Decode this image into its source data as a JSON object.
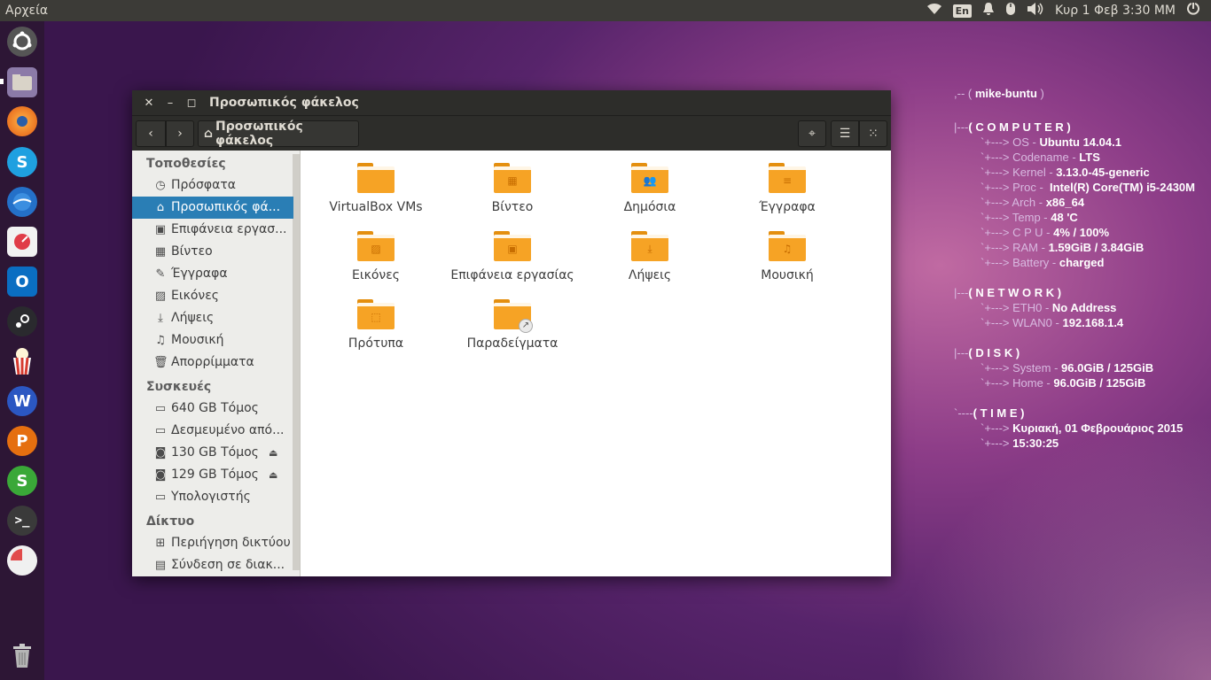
{
  "top_panel": {
    "app_title": "Αρχεία",
    "keyboard": "En",
    "datetime": "Κυρ  1 Φεβ  3:30 MM"
  },
  "window": {
    "title": "Προσωπικός φάκελος",
    "location": "Προσωπικός φάκελος"
  },
  "sidebar": {
    "places_header": "Τοποθεσίες",
    "places": [
      {
        "label": "Πρόσφατα",
        "icon": "clock-icon",
        "glyph": "◷"
      },
      {
        "label": "Προσωπικός φά...",
        "icon": "home-icon",
        "glyph": "⌂"
      },
      {
        "label": "Επιφάνεια εργασ...",
        "icon": "desktop-icon",
        "glyph": "▣"
      },
      {
        "label": "Βίντεο",
        "icon": "film-icon",
        "glyph": "▦"
      },
      {
        "label": "Έγγραφα",
        "icon": "document-icon",
        "glyph": "✎"
      },
      {
        "label": "Εικόνες",
        "icon": "image-icon",
        "glyph": "▨"
      },
      {
        "label": "Λήψεις",
        "icon": "download-icon",
        "glyph": "⤓"
      },
      {
        "label": "Μουσική",
        "icon": "music-icon",
        "glyph": "♫"
      },
      {
        "label": "Απορρίμματα",
        "icon": "trash-icon",
        "glyph": "🗑"
      }
    ],
    "devices_header": "Συσκευές",
    "devices": [
      {
        "label": "640 GB Τόμος",
        "icon": "drive-icon",
        "glyph": "▭"
      },
      {
        "label": "Δεσμευμένο από...",
        "icon": "drive-icon",
        "glyph": "▭"
      },
      {
        "label": "130 GB Τόμος",
        "icon": "usb-drive-icon",
        "glyph": "◙"
      },
      {
        "label": "129 GB Τόμος",
        "icon": "usb-drive-icon",
        "glyph": "◙"
      },
      {
        "label": "Υπολογιστής",
        "icon": "computer-icon",
        "glyph": "▭"
      }
    ],
    "network_header": "Δίκτυο",
    "network": [
      {
        "label": "Περιήγηση δικτύου",
        "icon": "network-icon",
        "glyph": "⊞"
      },
      {
        "label": "Σύνδεση σε διακ...",
        "icon": "server-icon",
        "glyph": "▤"
      }
    ]
  },
  "folders": [
    {
      "label": "VirtualBox VMs",
      "emblem": ""
    },
    {
      "label": "Βίντεο",
      "emblem": "▦"
    },
    {
      "label": "Δημόσια",
      "emblem": "👥"
    },
    {
      "label": "Έγγραφα",
      "emblem": "≡"
    },
    {
      "label": "Εικόνες",
      "emblem": "▨"
    },
    {
      "label": "Επιφάνεια εργασίας",
      "emblem": "▣"
    },
    {
      "label": "Λήψεις",
      "emblem": "⤓"
    },
    {
      "label": "Μουσική",
      "emblem": "♫"
    },
    {
      "label": "Πρότυπα",
      "emblem": "⬚"
    },
    {
      "label": "Παραδείγματα",
      "emblem": "",
      "badge": "↗"
    }
  ],
  "conky": {
    "hostname": "mike-buntu",
    "computer_header": "( C O M P U T E R )",
    "computer": [
      {
        "k": "OS",
        "v": "Ubuntu 14.04.1"
      },
      {
        "k": "Codename",
        "v": "LTS"
      },
      {
        "k": "Kernel",
        "v": "3.13.0-45-generic"
      },
      {
        "k": "Proc",
        "v": " Intel(R) Core(TM) i5-2430M"
      },
      {
        "k": "Arch",
        "v": "x86_64"
      },
      {
        "k": "Temp",
        "v": "48 'C"
      },
      {
        "k": "C P U",
        "v": "4% / 100%"
      },
      {
        "k": "RAM",
        "v": "1.59GiB / 3.84GiB"
      },
      {
        "k": "Battery",
        "v": "charged"
      }
    ],
    "network_header": "( N E T W O R K )",
    "network": [
      {
        "k": "ETH0",
        "v": "No Address"
      },
      {
        "k": "WLAN0",
        "v": "192.168.1.4"
      }
    ],
    "disk_header": "( D I S K )",
    "disk": [
      {
        "k": "System",
        "v": "96.0GiB / 125GiB"
      },
      {
        "k": "Home",
        "v": "96.0GiB / 125GiB"
      }
    ],
    "time_header": "( T I M E )",
    "time": [
      "Κυριακή, 01 Φεβρουάριος 2015",
      "15:30:25"
    ]
  },
  "colors": {
    "selection": "#2a7eb5",
    "folder": "#f6a325",
    "panel": "#3c3b37"
  }
}
